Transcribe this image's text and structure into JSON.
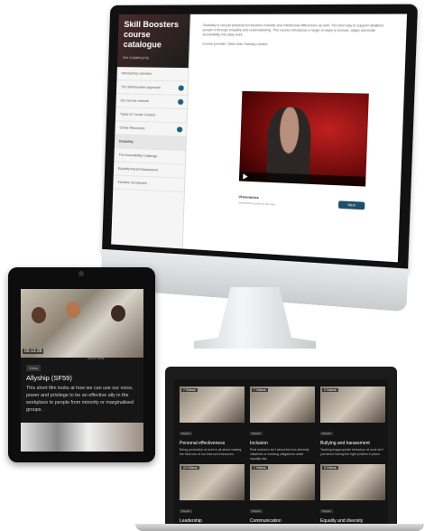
{
  "imac": {
    "catalogue_title": "Skill Boosters course catalogue",
    "progress_label": "3% COMPLETE",
    "sidebar_items": [
      {
        "label": "Introductory overview",
        "done": false,
        "active": false
      },
      {
        "label": "The Skill Boosters approach",
        "done": true,
        "active": false
      },
      {
        "label": "Our service network",
        "done": true,
        "active": false
      },
      {
        "label": "Types of Course Content",
        "done": false,
        "active": false
      },
      {
        "label": "Online Resources",
        "done": true,
        "active": false
      },
      {
        "label": "Disability",
        "done": false,
        "active": true
      },
      {
        "label": "The Accessibility Challenge",
        "done": false,
        "active": false
      },
      {
        "label": "Equality Impact Assessment",
        "done": false,
        "active": false
      },
      {
        "label": "Inclusive recruitment",
        "done": false,
        "active": false
      }
    ],
    "description": "Disability is not just physical but involves invisible and intellectual differences as well. The best way to support disabled people is through empathy and understanding. This course introduces a range of ways to include, adapt and build accessibility into daily work.",
    "description_credit": "Course provider: Video Arts Training Limited",
    "video_title": "Visionaries",
    "video_sub": "Introductory guide to the role",
    "next_label": "Next"
  },
  "tablet": {
    "time": "00:13:39",
    "caption": "Source: SF59",
    "tag": "Video",
    "title": "Allyship (SF59)",
    "description": "This short film looks at how we can use our voice, power and privilege to be an effective ally in the workplace to people from minority or marginalised groups."
  },
  "laptop": {
    "cards": [
      {
        "videos": "7 Videos",
        "tag": "Playlist",
        "name": "Personal effectiveness",
        "blurb": "Being productive at work is all about making the best use of our time and resources."
      },
      {
        "videos": "7 Videos",
        "tag": "Playlist",
        "name": "Inclusion",
        "blurb": "Real inclusion isn't about tick-box diversity initiatives or meeting obligations under equality law."
      },
      {
        "videos": "2 Videos",
        "tag": "Playlist",
        "name": "Bullying and harassment",
        "blurb": "Tackling inappropriate behaviour at work isn't just about having the right policies in place."
      },
      {
        "videos": "24 Videos",
        "tag": "Playlist",
        "name": "Leadership",
        "blurb": ""
      },
      {
        "videos": "7 Videos",
        "tag": "Playlist",
        "name": "Communication",
        "blurb": ""
      },
      {
        "videos": "9 Videos",
        "tag": "Playlist",
        "name": "Equality and diversity",
        "blurb": ""
      }
    ]
  }
}
